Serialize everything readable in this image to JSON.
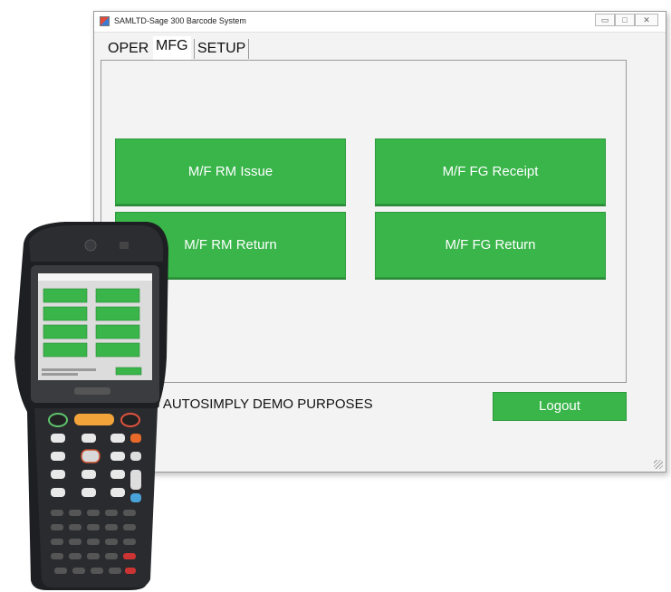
{
  "window": {
    "title": "SAMLTD-Sage 300 Barcode System",
    "controls": {
      "minimize": "▭",
      "maximize": "□",
      "close": "✕"
    }
  },
  "tabs": [
    {
      "label": "OPER"
    },
    {
      "label": "MFG",
      "active": true
    },
    {
      "label": "SETUP"
    }
  ],
  "actions": {
    "rm_issue": "M/F RM Issue",
    "fg_receipt": "M/F FG Receipt",
    "rm_return": "M/F RM Return",
    "fg_return": "M/F FG Return"
  },
  "status": {
    "text": "to AUTOSIMPLY DEMO PURPOSES"
  },
  "logout": {
    "label": "Logout"
  },
  "colors": {
    "button_green": "#39b54a",
    "window_bg": "#f3f3f3"
  },
  "device": {
    "image": "handheld-barcode-scanner"
  }
}
